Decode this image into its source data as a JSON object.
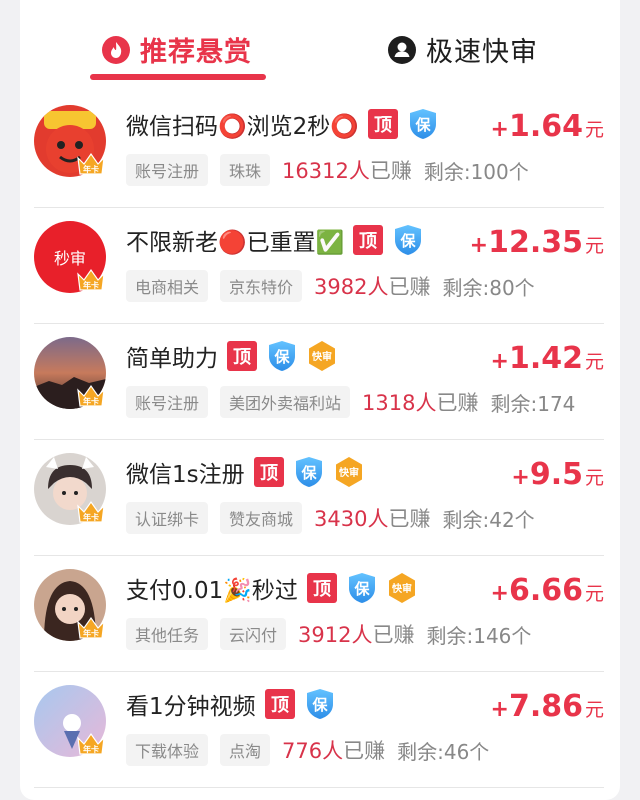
{
  "tabs": {
    "recommended": "推荐悬赏",
    "fast_review": "极速快审"
  },
  "colors": {
    "accent": "#e8344a",
    "top_badge": "#e8344a",
    "guarantee_badge": "#2d9cf0",
    "fast_badge": "#f5a623"
  },
  "badges": {
    "top": "顶",
    "guarantee": "保",
    "fast": "快审",
    "vip": "年卡"
  },
  "tasks": [
    {
      "title": "微信扫码⭕浏览2秒⭕",
      "tag1": "账号注册",
      "tag2": "珠珠",
      "earned": "16312人",
      "earned_suffix": "已赚",
      "remain": "剩余:100个",
      "price_sign": "+",
      "price": "1.64",
      "unit": "元",
      "badges": [
        "top",
        "guarantee"
      ],
      "avatar": "red-mascot",
      "avatar_text": ""
    },
    {
      "title": "不限新老🔴已重置✅",
      "tag1": "电商相关",
      "tag2": "京东特价",
      "earned": "3982人",
      "earned_suffix": "已赚",
      "remain": "剩余:80个",
      "price_sign": "+",
      "price": "12.35",
      "unit": "元",
      "badges": [
        "top",
        "guarantee"
      ],
      "avatar": "red-circle",
      "avatar_text": "秒审"
    },
    {
      "title": "简单助力",
      "tag1": "账号注册",
      "tag2": "美团外卖福利站",
      "earned": "1318人",
      "earned_suffix": "已赚",
      "remain": "剩余:174",
      "price_sign": "+",
      "price": "1.42",
      "unit": "元",
      "badges": [
        "top",
        "guarantee",
        "fast"
      ],
      "avatar": "sunset",
      "avatar_text": ""
    },
    {
      "title": "微信1s注册",
      "tag1": "认证绑卡",
      "tag2": "赞友商城",
      "earned": "3430人",
      "earned_suffix": "已赚",
      "remain": "剩余:42个",
      "price_sign": "+",
      "price": "9.5",
      "unit": "元",
      "badges": [
        "top",
        "guarantee",
        "fast"
      ],
      "avatar": "girl-cat",
      "avatar_text": ""
    },
    {
      "title": "支付0.01🎉秒过",
      "tag1": "其他任务",
      "tag2": "云闪付",
      "earned": "3912人",
      "earned_suffix": "已赚",
      "remain": "剩余:146个",
      "price_sign": "+",
      "price": "6.66",
      "unit": "元",
      "badges": [
        "top",
        "guarantee",
        "fast"
      ],
      "avatar": "girl-dark",
      "avatar_text": ""
    },
    {
      "title": "看1分钟视频",
      "tag1": "下载体验",
      "tag2": "点淘",
      "earned": "776人",
      "earned_suffix": "已赚",
      "remain": "剩余:46个",
      "price_sign": "+",
      "price": "7.86",
      "unit": "元",
      "badges": [
        "top",
        "guarantee"
      ],
      "avatar": "sky",
      "avatar_text": ""
    }
  ]
}
